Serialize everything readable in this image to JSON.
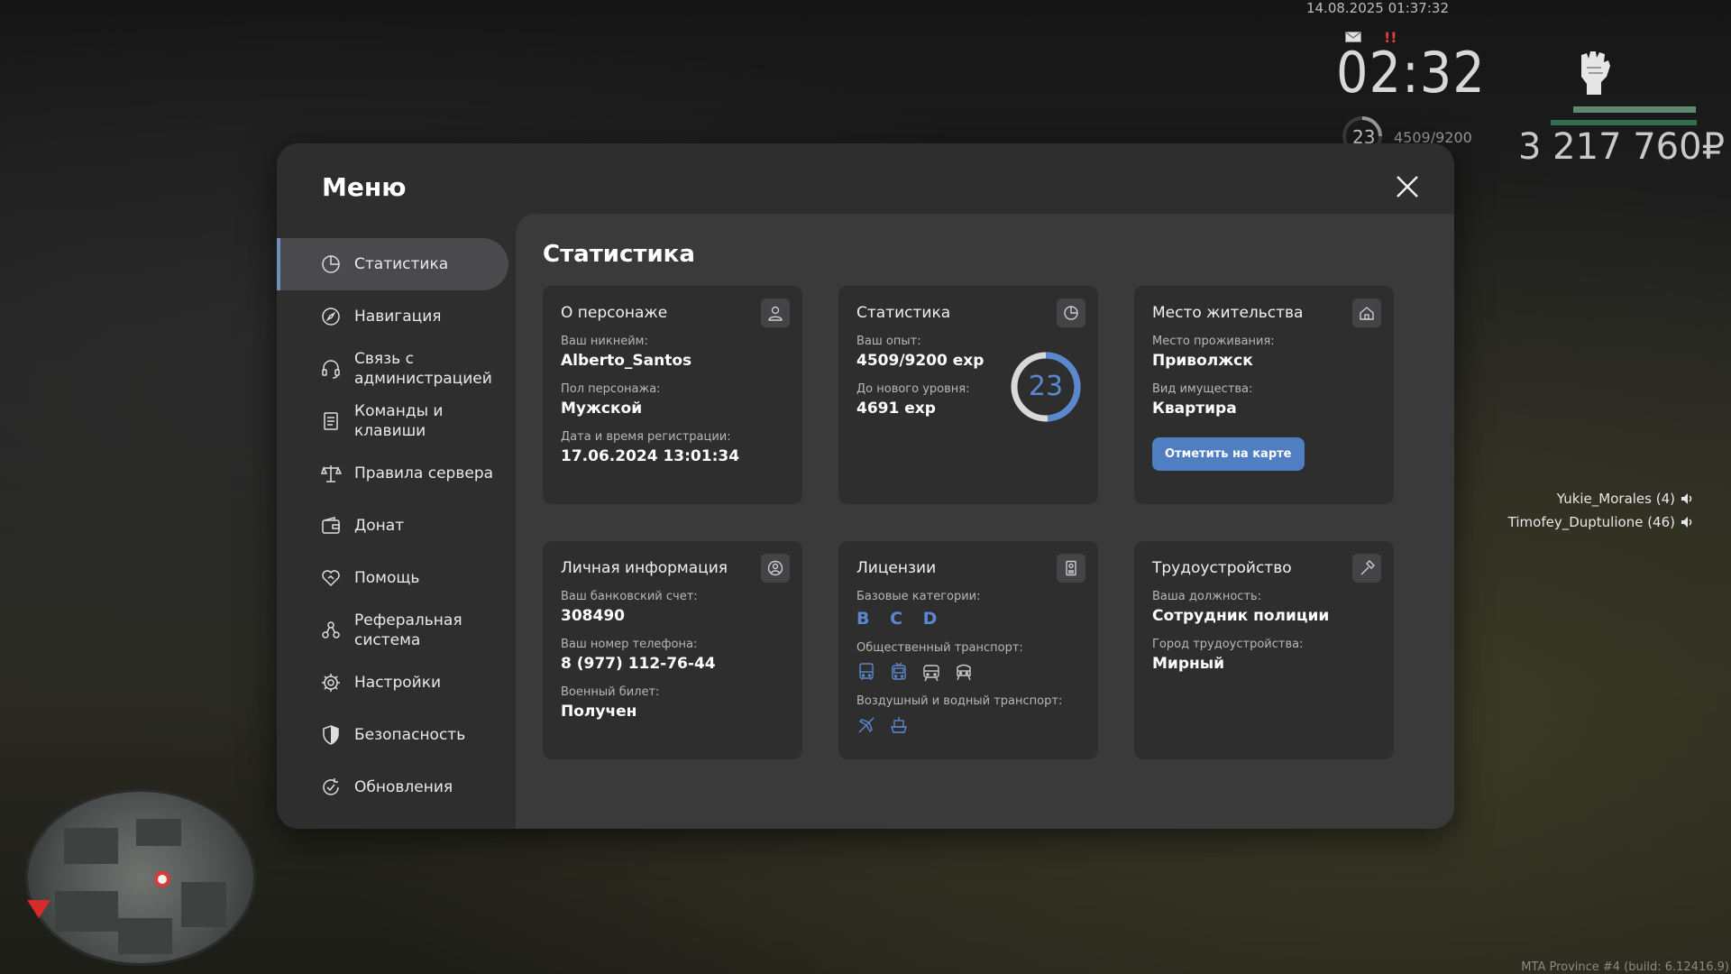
{
  "hud": {
    "datetime": "14.08.2025 01:37:32",
    "alert": "!!",
    "clock": "02:32",
    "level": "23",
    "exp": "4509/9200",
    "money": "3 217 760₽",
    "players": [
      {
        "name": "Yukie_Morales (4)"
      },
      {
        "name": "Timofey_Duptulione (46)"
      }
    ],
    "footer": "MTA Province #4 (build: 6.12416.9)"
  },
  "menu": {
    "title": "Меню",
    "nav": [
      {
        "label": "Статистика",
        "icon": "chart-pie-icon",
        "active": true
      },
      {
        "label": "Навигация",
        "icon": "compass-icon"
      },
      {
        "label": "Связь с администрацией",
        "icon": "headset-icon"
      },
      {
        "label": "Команды и клавиши",
        "icon": "document-icon"
      },
      {
        "label": "Правила сервера",
        "icon": "scales-icon"
      },
      {
        "label": "Донат",
        "icon": "wallet-icon"
      },
      {
        "label": "Помощь",
        "icon": "heart-handshake-icon"
      },
      {
        "label": "Реферальная система",
        "icon": "referral-icon"
      },
      {
        "label": "Настройки",
        "icon": "gear-icon"
      },
      {
        "label": "Безопасность",
        "icon": "shield-icon"
      },
      {
        "label": "Обновления",
        "icon": "refresh-check-icon"
      }
    ],
    "content_title": "Статистика",
    "cards": {
      "character": {
        "title": "О персонаже",
        "nickname_label": "Ваш никнейм:",
        "nickname": "Alberto_Santos",
        "gender_label": "Пол персонажа:",
        "gender": "Мужской",
        "reg_label": "Дата и время регистрации:",
        "reg": "17.06.2024 13:01:34"
      },
      "stats": {
        "title": "Статистика",
        "exp_label": "Ваш опыт:",
        "exp": "4509/9200 exp",
        "next_label": "До нового уровня:",
        "next": "4691 exp",
        "level": "23",
        "progress": 0.49
      },
      "residence": {
        "title": "Место жительства",
        "place_label": "Место проживания:",
        "place": "Приволжск",
        "property_label": "Вид имущества:",
        "property": "Квартира",
        "button": "Отметить на карте"
      },
      "personal": {
        "title": "Личная информация",
        "bank_label": "Ваш банковский счет:",
        "bank": "308490",
        "phone_label": "Ваш номер телефона:",
        "phone": "8 (977) 112-76-44",
        "military_label": "Военный билет:",
        "military": "Получен"
      },
      "licenses": {
        "title": "Лицензии",
        "base_label": "Базовые категории:",
        "base": "B C D",
        "public_label": "Общественный транспорт:",
        "air_label": "Воздушный и водный транспорт:"
      },
      "job": {
        "title": "Трудоустройство",
        "position_label": "Ваша должность:",
        "position": "Сотрудник полиции",
        "city_label": "Город трудоустройства:",
        "city": "Мирный"
      }
    }
  },
  "colors": {
    "accent": "#5a88cf",
    "button": "#4f7ec3",
    "panel": "#2e2e2f",
    "content": "#3a3a3b"
  }
}
